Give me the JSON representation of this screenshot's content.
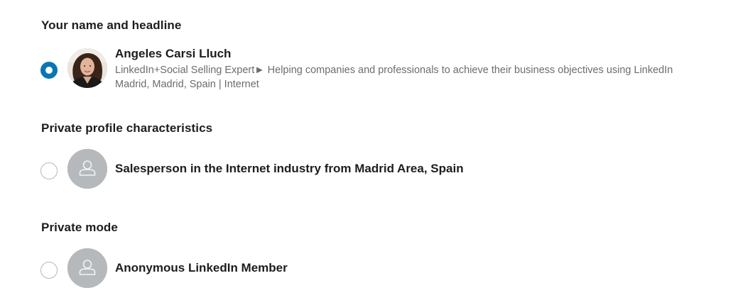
{
  "sections": [
    {
      "title": "Your name and headline",
      "option": {
        "selected": true,
        "name": "Angeles Carsi Lluch",
        "headline": "LinkedIn+Social Selling Expert► Helping companies and professionals to achieve their business objectives using LinkedIn",
        "location": "Madrid, Madrid, Spain | Internet",
        "avatar": "profile-photo"
      }
    },
    {
      "title": "Private profile characteristics",
      "option": {
        "selected": false,
        "name": "Salesperson in the Internet industry from Madrid Area, Spain",
        "avatar": "person-silhouette-icon"
      }
    },
    {
      "title": "Private mode",
      "option": {
        "selected": false,
        "name": "Anonymous LinkedIn Member",
        "avatar": "person-silhouette-icon"
      }
    }
  ],
  "colors": {
    "radio_selected": "#0a75b3",
    "radio_border": "#b3b6b9",
    "avatar_placeholder": "#b6b9bc",
    "secondary_text": "#6a6d70"
  }
}
